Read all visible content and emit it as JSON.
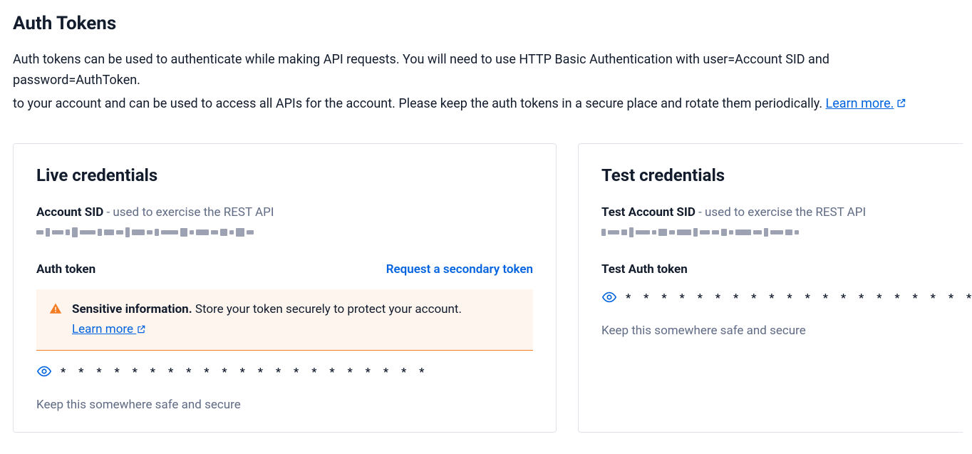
{
  "header": {
    "title": "Auth Tokens",
    "desc_line1": "Auth tokens can be used to authenticate while making API requests. You will need to use HTTP Basic Authentication with user=Account SID and password=AuthToken.",
    "desc_line2_prefix": "to your account and can be used to access all APIs for the account. Please keep the auth tokens in a secure place and rotate them periodically. ",
    "learn_more": "Learn more."
  },
  "live": {
    "card_title": "Live credentials",
    "sid_label": "Account SID",
    "sid_hint": " - used to exercise the REST API",
    "auth_label": "Auth token",
    "request_secondary": "Request a secondary token",
    "alert_bold": "Sensitive information.",
    "alert_text": " Store your token securely to protect your account.",
    "alert_learn": "Learn more",
    "masked": "* * * * * * * * * * * * * * * * * * * * *",
    "helper": "Keep this somewhere safe and secure"
  },
  "test": {
    "card_title": "Test credentials",
    "sid_label": "Test Account SID",
    "sid_hint": " - used to exercise the REST API",
    "auth_label": "Test Auth token",
    "masked": "* * * * * * * * * * * * * * * * * * * * *",
    "helper": "Keep this somewhere safe and secure"
  }
}
